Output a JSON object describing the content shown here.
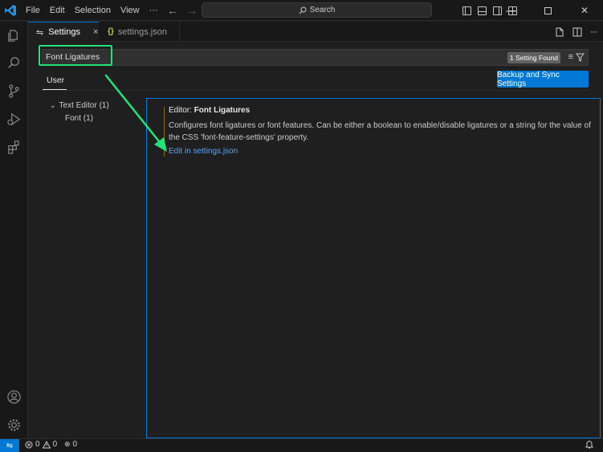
{
  "menu": {
    "file": "File",
    "edit": "Edit",
    "selection": "Selection",
    "view": "View",
    "more": "···"
  },
  "command_center": {
    "search_label": "Search"
  },
  "tabs": [
    {
      "label": "Settings",
      "active": true,
      "close": "×"
    },
    {
      "label": "settings.json",
      "active": false,
      "icon_text": "{}"
    }
  ],
  "settings": {
    "search_value": "Font Ligatures",
    "result_badge": "1 Setting Found",
    "scope_tab": "User",
    "sync_button": "Backup and Sync Settings",
    "toc": [
      {
        "label": "Text Editor (1)",
        "expanded": true
      },
      {
        "label": "Font (1)"
      }
    ],
    "item": {
      "category": "Editor: ",
      "name": "Font Ligatures",
      "description_line1": "Configures font ligatures or font features. Can be either a boolean to enable/disable ligatures or a string for the value of",
      "description_line2": "the CSS 'font-feature-settings' property.",
      "link": "Edit in settings.json"
    }
  },
  "statusbar": {
    "errors": "0",
    "warnings": "0",
    "ports": "0"
  },
  "colors": {
    "accent": "#0078d4",
    "annotation": "#22e37a",
    "link": "#4daafc"
  },
  "icons": [
    "vscode-logo-icon",
    "back-arrow-icon",
    "forward-arrow-icon",
    "search-icon",
    "files-icon",
    "search-activity-icon",
    "source-control-icon",
    "run-debug-icon",
    "extensions-icon",
    "account-icon",
    "manage-gear-icon",
    "clear-filter-icon",
    "filter-icon",
    "open-json-icon",
    "split-editor-icon",
    "more-actions-icon",
    "remote-icon",
    "error-icon",
    "warning-icon",
    "ports-icon",
    "bell-icon"
  ]
}
